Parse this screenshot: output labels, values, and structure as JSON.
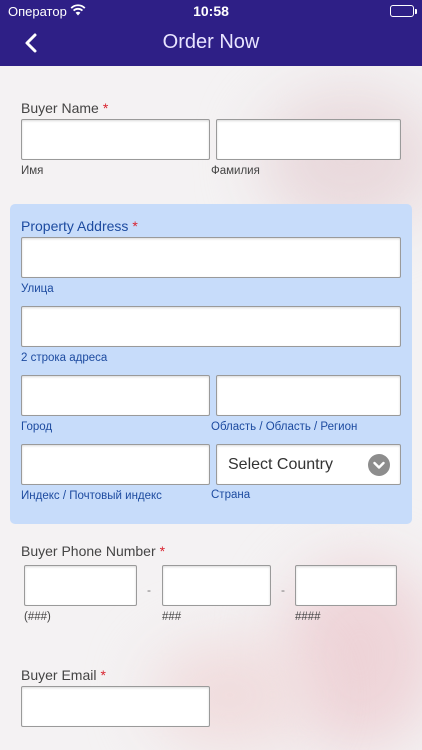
{
  "status_bar": {
    "carrier": "Оператор",
    "time": "10:58"
  },
  "nav": {
    "title": "Order Now"
  },
  "buyer_name": {
    "label": "Buyer Name",
    "required_mark": "*",
    "first_sub": "Имя",
    "last_sub": "Фамилия"
  },
  "address": {
    "label": "Property Address",
    "required_mark": "*",
    "street_sub": "Улица",
    "line2_sub": "2 строка адреса",
    "city_sub": "Город",
    "region_sub": "Область / Область / Регион",
    "zip_sub": "Индекс / Почтовый индекс",
    "country_sub": "Страна",
    "country_select": "Select Country"
  },
  "phone": {
    "label": "Buyer Phone Number",
    "required_mark": "*",
    "sep": "-",
    "area_sub": "(###)",
    "prefix_sub": "###",
    "line_sub": "####"
  },
  "email": {
    "label": "Buyer Email",
    "required_mark": "*"
  },
  "colors": {
    "nav": "#2e1f86",
    "panel": "#c7dcfa",
    "required": "#d9232f"
  }
}
